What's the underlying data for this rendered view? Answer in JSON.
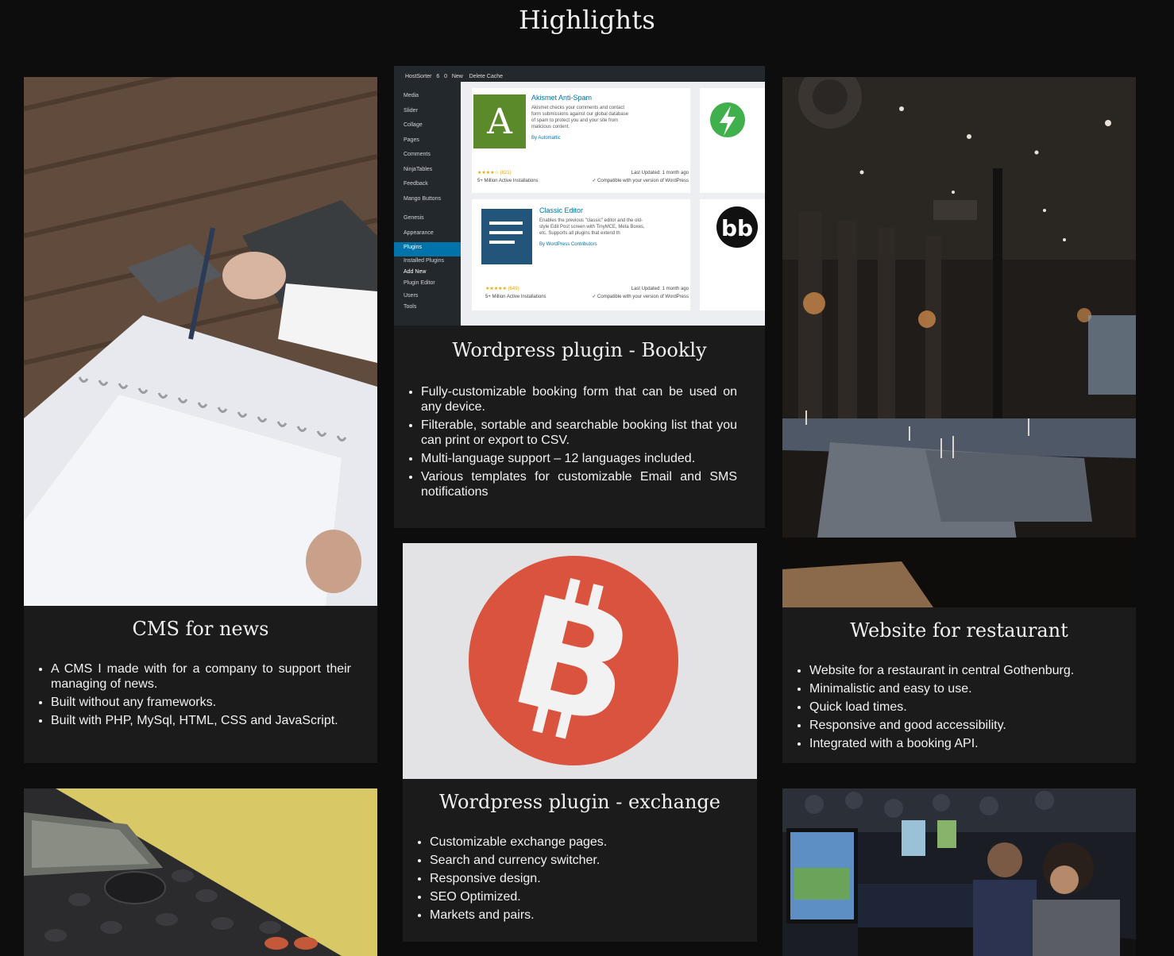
{
  "page": {
    "title": "Highlights"
  },
  "projects": [
    {
      "title": "CMS for news",
      "image_alt": "hands-writing-planner-photo",
      "bullets": [
        "A CMS I made with for a company to support their managing of news.",
        "Built without any frameworks.",
        "Built with PHP, MySql, HTML, CSS and JavaScript."
      ]
    },
    {
      "title": "Wordpress plugin - Bookly",
      "image_alt": "wordpress-plugins-screenshot",
      "screenshot": {
        "topbar": [
          "HostSorter",
          "6",
          "0",
          "New",
          "Delete Cache"
        ],
        "menu": [
          "Media",
          "Slider",
          "Collage",
          "Pages",
          "Comments",
          "NinjaTables",
          "Feedback",
          "Mango Buttons",
          "Genesis",
          "Appearance",
          "Plugins",
          "Installed Plugins",
          "Add New",
          "Plugin Editor",
          "Users",
          "Tools"
        ],
        "plugin1_name": "Akismet Anti-Spam",
        "plugin1_desc": "Akismet checks your comments and contact form submissions against our global database of spam to protect you and your site from malicious content.",
        "plugin1_author": "By Automattic",
        "plugin1_rating": "★★★★☆ (821)",
        "plugin1_installs": "5+ Million Active Installations",
        "plugin2_name": "Classic Editor",
        "plugin2_desc": "Enables the previous \"classic\" editor and the old-style Edit Post screen with TinyMCE, Meta Boxes, etc. Supports all plugins that extend th",
        "plugin2_author": "By WordPress Contributors",
        "plugin2_rating": "★★★★★ (649)",
        "plugin2_installs": "5+ Million Active Installations",
        "last_updated": "Last Updated: 1 month ago",
        "compatible": "✓ Compatible with your version of WordPress"
      },
      "bullets": [
        "Fully-customizable booking form that can be used on any device.",
        "Filterable, sortable and searchable booking list that you can print or export to CSV.",
        "Multi-language support – 12 languages included.",
        "Various templates for customizable Email and SMS notifications"
      ]
    },
    {
      "title": "Website for restaurant",
      "image_alt": "dark-restaurant-interior-photo",
      "bullets": [
        "Website for a restaurant in central Gothenburg.",
        "Minimalistic and easy to use.",
        "Quick load times.",
        "Responsive and good accessibility.",
        "Integrated with a booking API."
      ]
    },
    {
      "title": "Wordpress plugin - exchange",
      "image_alt": "bitcoin-logo-photo",
      "bullets": [
        "Customizable exchange pages.",
        "Search and currency switcher.",
        "Responsive design.",
        "SEO Optimized.",
        "Markets and pairs."
      ]
    },
    {
      "image_alt": "calculator-on-yellow-photo"
    },
    {
      "image_alt": "gaming-event-photo"
    }
  ],
  "colors": {
    "background": "#0d0d0d",
    "card": "#1b1b1b",
    "bitcoin": "#d9533f",
    "wp_green": "#5a8a2a",
    "wp_blue": "#23557a"
  }
}
